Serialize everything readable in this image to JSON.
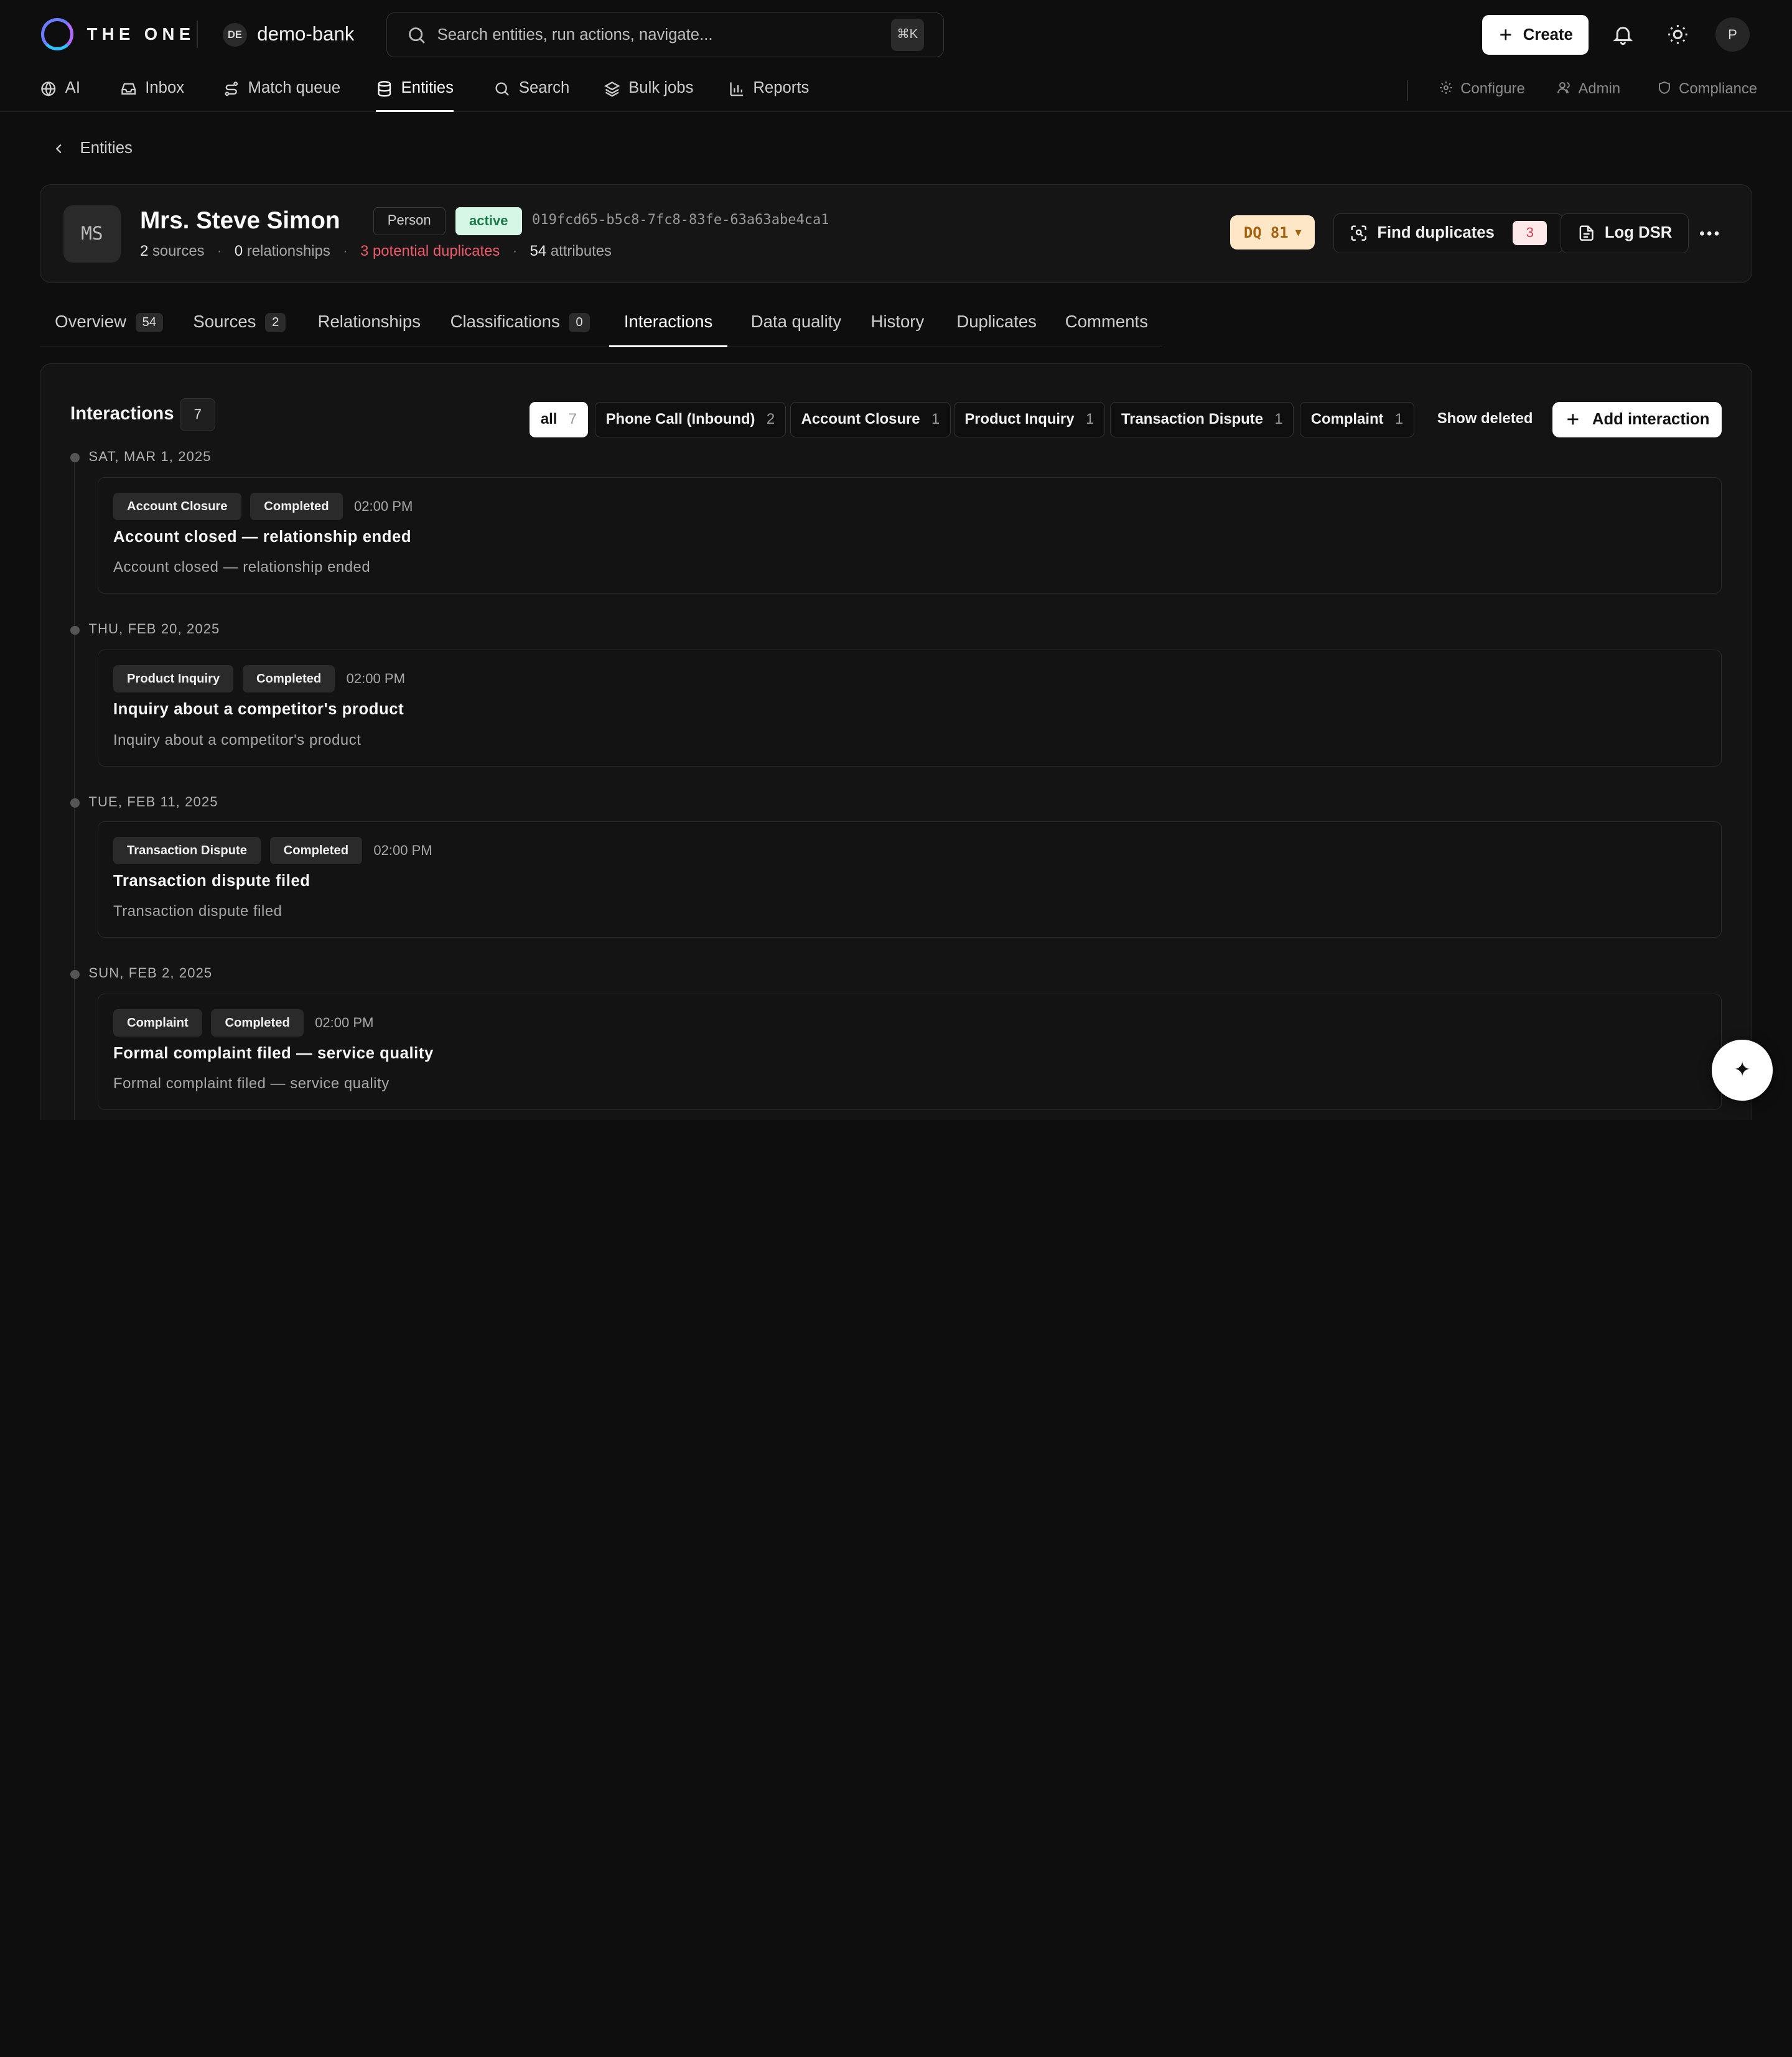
{
  "app": {
    "brand": "THE ONE",
    "tenant_initials": "DE",
    "tenant_name": "demo-bank"
  },
  "search": {
    "placeholder": "Search entities, run actions, navigate...",
    "shortcut": "⌘K"
  },
  "header": {
    "create_label": "Create",
    "avatar_initial": "P"
  },
  "nav": {
    "items": [
      {
        "label": "AI",
        "icon": "globe-icon"
      },
      {
        "label": "Inbox",
        "icon": "inbox-icon"
      },
      {
        "label": "Match queue",
        "icon": "route-icon"
      },
      {
        "label": "Entities",
        "icon": "database-icon",
        "active": true
      },
      {
        "label": "Search",
        "icon": "search-icon"
      },
      {
        "label": "Bulk jobs",
        "icon": "layers-icon"
      },
      {
        "label": "Reports",
        "icon": "bar-chart-icon"
      }
    ],
    "right": [
      {
        "label": "Configure",
        "icon": "gear-icon"
      },
      {
        "label": "Admin",
        "icon": "users-icon"
      },
      {
        "label": "Compliance",
        "icon": "shield-icon"
      }
    ]
  },
  "breadcrumb": {
    "label": "Entities"
  },
  "entity": {
    "initials": "MS",
    "name": "Mrs. Steve Simon",
    "type": "Person",
    "status": "active",
    "id": "019fcd65-b5c8-7fc8-83fe-63a63abe4ca1",
    "meta": {
      "sources_count": "2",
      "sources_label": "sources",
      "relationships_count": "0",
      "relationships_label": "relationships",
      "duplicates_text": "3 potential duplicates",
      "attributes_count": "54",
      "attributes_label": "attributes"
    },
    "dq_label": "DQ 81",
    "find_duplicates_label": "Find duplicates",
    "find_duplicates_count": "3",
    "log_dsr_label": "Log DSR"
  },
  "tabs": [
    {
      "label": "Overview",
      "count": "54"
    },
    {
      "label": "Sources",
      "count": "2"
    },
    {
      "label": "Relationships"
    },
    {
      "label": "Classifications",
      "count": "0"
    },
    {
      "label": "Interactions",
      "active": true
    },
    {
      "label": "Data quality"
    },
    {
      "label": "History"
    },
    {
      "label": "Duplicates"
    },
    {
      "label": "Comments"
    }
  ],
  "interactions": {
    "title": "Interactions",
    "count": "7",
    "filters": [
      {
        "label": "all",
        "count": "7",
        "active": true
      },
      {
        "label": "Phone Call (Inbound)",
        "count": "2"
      },
      {
        "label": "Account Closure",
        "count": "1"
      },
      {
        "label": "Product Inquiry",
        "count": "1"
      },
      {
        "label": "Transaction Dispute",
        "count": "1"
      },
      {
        "label": "Complaint",
        "count": "1"
      }
    ],
    "show_deleted_label": "Show deleted",
    "add_label": "Add interaction",
    "days": [
      {
        "date": "SAT, MAR 1, 2025",
        "type": "Account Closure",
        "status": "Completed",
        "time": "02:00 PM",
        "title": "Account closed — relationship ended",
        "description": "Account closed — relationship ended"
      },
      {
        "date": "THU, FEB 20, 2025",
        "type": "Product Inquiry",
        "status": "Completed",
        "time": "02:00 PM",
        "title": "Inquiry about a competitor's product",
        "description": "Inquiry about a competitor's product"
      },
      {
        "date": "TUE, FEB 11, 2025",
        "type": "Transaction Dispute",
        "status": "Completed",
        "time": "02:00 PM",
        "title": "Transaction dispute filed",
        "description": "Transaction dispute filed"
      },
      {
        "date": "SUN, FEB 2, 2025",
        "type": "Complaint",
        "status": "Completed",
        "time": "02:00 PM",
        "title": "Formal complaint filed — service quality",
        "description": "Formal complaint filed — service quality"
      }
    ]
  },
  "fab": {
    "icon": "sparkle-icon",
    "glyph": "✦"
  }
}
